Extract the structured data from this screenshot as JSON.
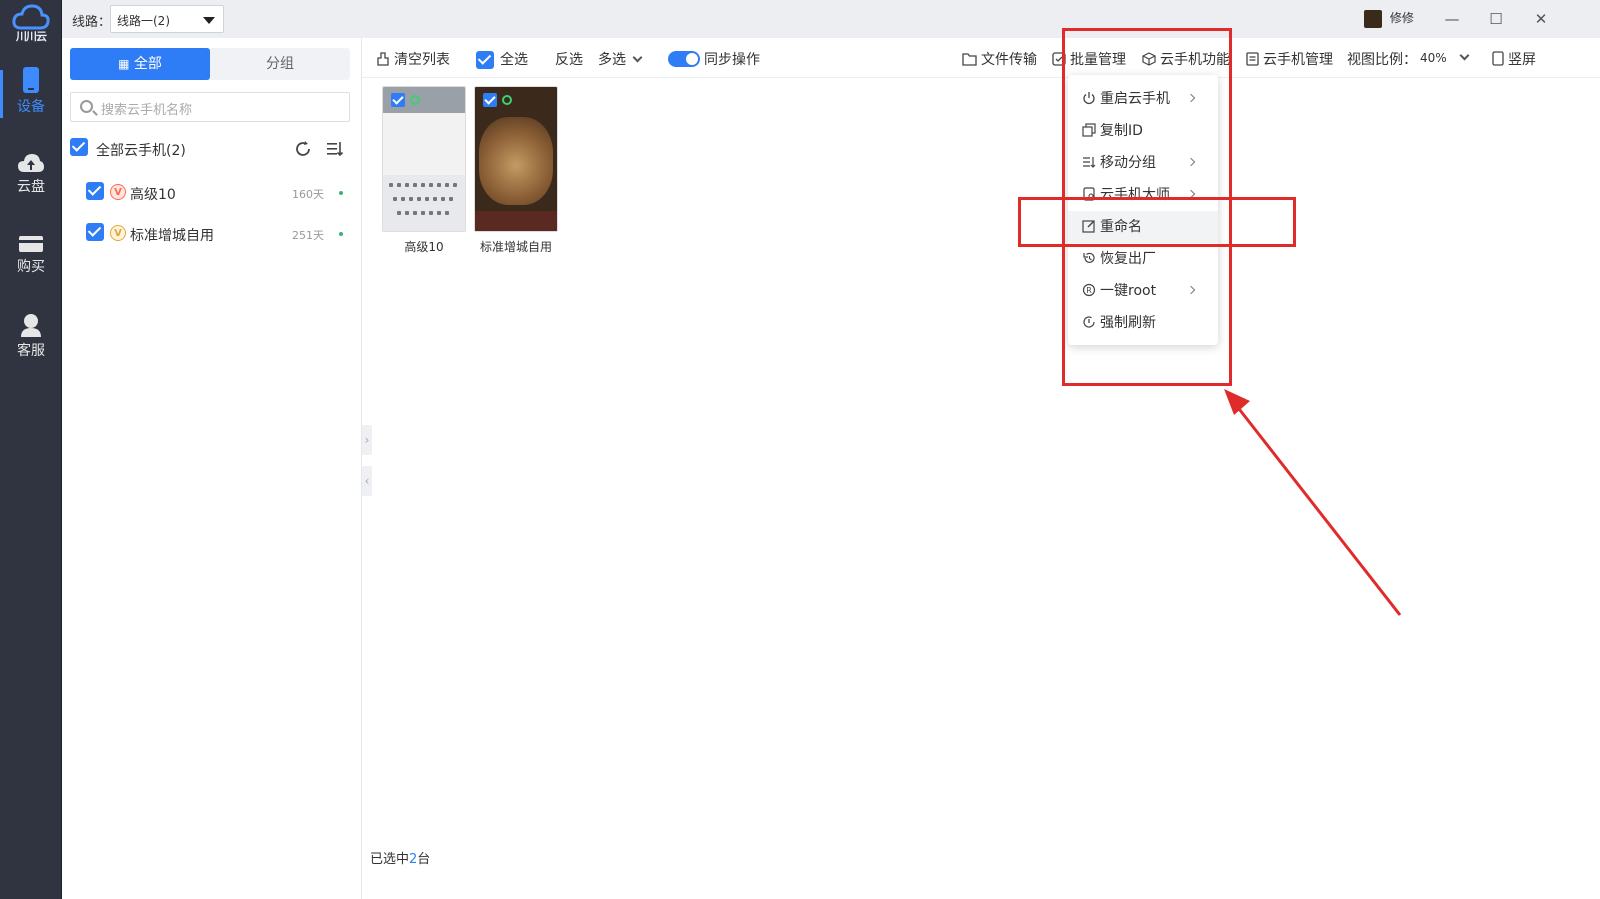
{
  "app": {
    "logo_text": "川川云",
    "route_label": "线路：",
    "route_value": "线路一(2)",
    "user_name": "修修",
    "window": {
      "minimize": "—",
      "maximize": "☐",
      "close": "✕"
    }
  },
  "nav": {
    "items": [
      {
        "label": "设备",
        "icon": "phone-icon",
        "active": true
      },
      {
        "label": "云盘",
        "icon": "cloud-upload-icon",
        "active": false
      },
      {
        "label": "购买",
        "icon": "card-icon",
        "active": false
      },
      {
        "label": "客服",
        "icon": "support-icon",
        "active": false
      }
    ]
  },
  "sidebar": {
    "tabs": [
      {
        "label": "全部"
      },
      {
        "label": "分组"
      }
    ],
    "search_placeholder": "搜索云手机名称",
    "all_label": "全部云手机(2)",
    "devices": [
      {
        "name": "高级10",
        "vip": "V",
        "vip_color": "#ff6b4a",
        "days": "160天"
      },
      {
        "name": "标准增城自用",
        "vip": "V",
        "vip_color": "#e0a83a",
        "days": "251天"
      }
    ]
  },
  "toolbar": {
    "clear_list": "清空列表",
    "select_all": "全选",
    "invert": "反选",
    "multi": "多选",
    "sync": "同步操作",
    "file_transfer": "文件传输",
    "batch_manage": "批量管理",
    "phone_functions": "云手机功能",
    "phone_manage": "云手机管理",
    "view_ratio_label": "视图比例：",
    "view_ratio_value": "40%",
    "portrait": "竖屏"
  },
  "phones": [
    {
      "label": "高级10"
    },
    {
      "label": "标准增城自用"
    }
  ],
  "status": {
    "prefix": "已选中",
    "count": "2",
    "suffix": "台"
  },
  "menu": {
    "items": [
      {
        "label": "重启云手机",
        "icon": "power-icon",
        "submenu": true
      },
      {
        "label": "复制ID",
        "icon": "copy-icon",
        "submenu": false
      },
      {
        "label": "移动分组",
        "icon": "move-group-icon",
        "submenu": true
      },
      {
        "label": "云手机大师",
        "icon": "master-icon",
        "submenu": true
      },
      {
        "label": "重命名",
        "icon": "edit-icon",
        "submenu": false
      },
      {
        "label": "恢复出厂",
        "icon": "restore-icon",
        "submenu": false
      },
      {
        "label": "一键root",
        "icon": "root-icon",
        "submenu": true
      },
      {
        "label": "强制刷新",
        "icon": "force-refresh-icon",
        "submenu": false
      }
    ]
  },
  "colors": {
    "accent": "#2f7df6",
    "annotation": "#e02b2b",
    "nav_bg": "#2f3440"
  }
}
